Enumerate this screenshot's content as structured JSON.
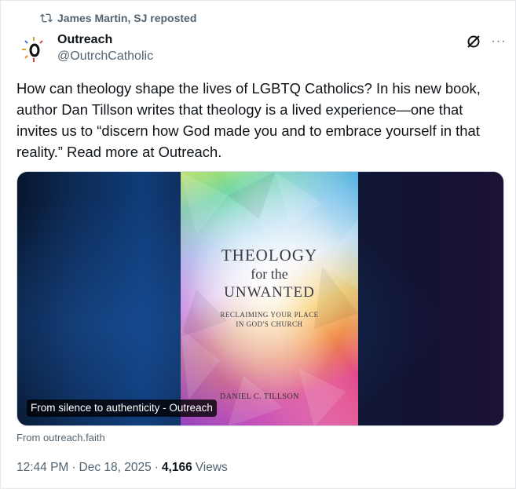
{
  "repost": {
    "label": "James Martin, SJ reposted",
    "icon": "repost-icon"
  },
  "author": {
    "name": "Outreach",
    "handle": "@OutrchCatholic",
    "avatar_icon": "outreach-logo"
  },
  "actions": {
    "grok_icon": "grok-icon",
    "more_icon": "more-icon",
    "more_glyph": "···"
  },
  "post": {
    "text": "How can theology shape the lives of LGBTQ Catholics? In his new book, author Dan Tillson writes that theology is a lived experience—one that invites us to “discern how God made you and to embrace yourself in that reality.” Read more at Outreach."
  },
  "media": {
    "caption": "From silence to authenticity - Outreach",
    "cover": {
      "title_line1": "THEOLOGY",
      "title_line2": "for the",
      "title_line3": "UNWANTED",
      "subtitle_line1": "RECLAIMING YOUR PLACE",
      "subtitle_line2": "IN GOD'S CHURCH",
      "author": "DANIEL C. TILLSON"
    },
    "source": "From outreach.faith"
  },
  "meta": {
    "time": "12:44 PM",
    "date": "Dec 18, 2025",
    "views_count": "4,166",
    "views_label": "Views"
  },
  "colors": {
    "text_primary": "#0f1419",
    "text_secondary": "#536471",
    "border": "#cfd9de"
  }
}
